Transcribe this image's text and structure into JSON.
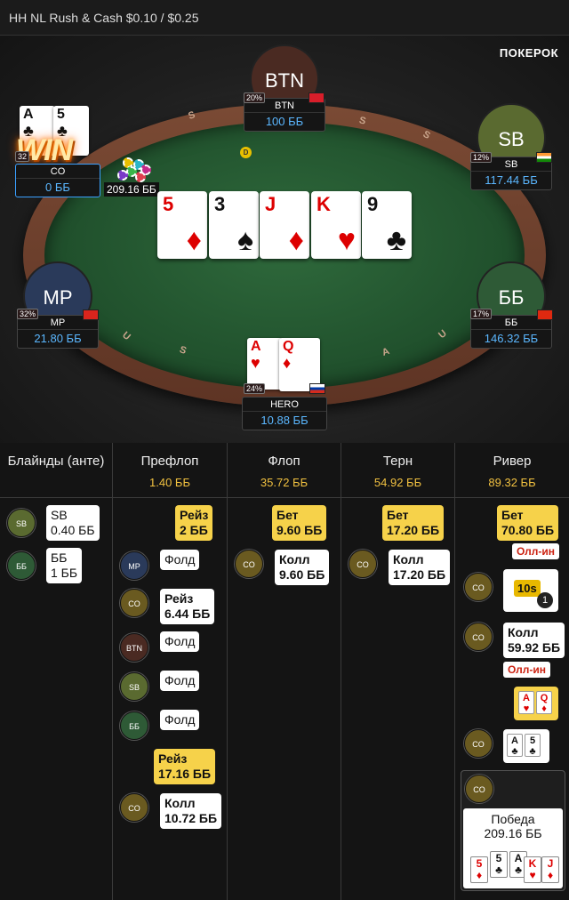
{
  "title": "HH NL Rush & Cash $0.10 / $0.25",
  "logo": "ПОКЕРОК",
  "pot": "209.16 ББ",
  "win_text": "WIN",
  "seats": {
    "btn": {
      "avatar": "BTN",
      "name": "BTN",
      "stack": "100 ББ",
      "pct": "20%",
      "color": "#4a2a22"
    },
    "sb": {
      "avatar": "SB",
      "name": "SB",
      "stack": "117.44 ББ",
      "pct": "12%",
      "color": "#5a6a30"
    },
    "bb": {
      "avatar": "ББ",
      "name": "ББ",
      "stack": "146.32 ББ",
      "pct": "17%",
      "color": "#2e5a36"
    },
    "mp": {
      "avatar": "MP",
      "name": "MP",
      "stack": "21.80 ББ",
      "pct": "32%",
      "color": "#2a3a5a"
    },
    "co": {
      "name": "CO",
      "stack": "0 ББ",
      "pct": "32"
    },
    "hero": {
      "name": "HERO",
      "stack": "10.88 ББ",
      "pct": "24%"
    }
  },
  "co_cards": [
    {
      "rank": "A",
      "suit": "♣"
    },
    {
      "rank": "5",
      "suit": "♣"
    }
  ],
  "hero_cards": [
    {
      "rank": "A",
      "suit": "♥"
    },
    {
      "rank": "Q",
      "suit": "♦"
    }
  ],
  "board": [
    {
      "rank": "5",
      "suit": "♦",
      "red": true
    },
    {
      "rank": "3",
      "suit": "♠",
      "red": false
    },
    {
      "rank": "J",
      "suit": "♦",
      "red": true
    },
    {
      "rank": "K",
      "suit": "♥",
      "red": true
    },
    {
      "rank": "9",
      "suit": "♣",
      "red": false
    }
  ],
  "rail_letters": [
    "S",
    "U",
    "S",
    "S",
    "A",
    "U",
    "S"
  ],
  "history": {
    "blinds": {
      "title": "Блайнды (анте)",
      "sb_label": "SB",
      "sb_amount": "0.40 ББ",
      "bb_label": "ББ",
      "bb_amount": "1 ББ",
      "sb_pos": "SB",
      "bb_pos": "ББ"
    },
    "preflop": {
      "title": "Префлоп",
      "total": "1.40 ББ",
      "raise1": [
        "Рейз",
        "2 ББ"
      ],
      "mp_pos": "MP",
      "mp_action": "Фолд",
      "co_pos": "CO",
      "co_raise": [
        "Рейз",
        "6.44 ББ"
      ],
      "btn_pos": "BTN",
      "btn_action": "Фолд",
      "sb_pos": "SB",
      "sb_action": "Фолд",
      "bb_pos": "ББ",
      "bb_action": "Фолд",
      "raise2": [
        "Рейз",
        "17.16 ББ"
      ],
      "co_call_pos": "CO",
      "co_call": [
        "Колл",
        "10.72 ББ"
      ]
    },
    "flop": {
      "title": "Флоп",
      "total": "35.72 ББ",
      "bet": [
        "Бет",
        "9.60 ББ"
      ],
      "co_pos": "CO",
      "call": [
        "Колл",
        "9.60 ББ"
      ]
    },
    "turn": {
      "title": "Терн",
      "total": "54.92 ББ",
      "bet": [
        "Бет",
        "17.20 ББ"
      ],
      "co_pos": "CO",
      "call": [
        "Колл",
        "17.20 ББ"
      ]
    },
    "river": {
      "title": "Ривер",
      "total": "89.32 ББ",
      "bet": [
        "Бет",
        "70.80 ББ"
      ],
      "allin1": "Олл-ин",
      "co_pos1": "CO",
      "timer": "10s",
      "timer_count": "1",
      "co_pos2": "CO",
      "call": [
        "Колл",
        "59.92 ББ"
      ],
      "allin2": "Олл-ин",
      "co_pos3": "CO",
      "win_pos": "CO",
      "win_label": "Победа",
      "win_amount": "209.16 ББ",
      "hero_show": [
        {
          "rank": "A",
          "suit": "♥"
        },
        {
          "rank": "Q",
          "suit": "♦"
        }
      ],
      "co_show": [
        {
          "rank": "A",
          "suit": "♣"
        },
        {
          "rank": "5",
          "suit": "♣"
        }
      ],
      "win_hand": [
        {
          "rank": "5",
          "suit": "♦"
        },
        {
          "rank": "5",
          "suit": "♣"
        },
        {
          "rank": "A",
          "suit": "♣"
        },
        {
          "rank": "K",
          "suit": "♥"
        },
        {
          "rank": "J",
          "suit": "♦"
        }
      ]
    }
  }
}
